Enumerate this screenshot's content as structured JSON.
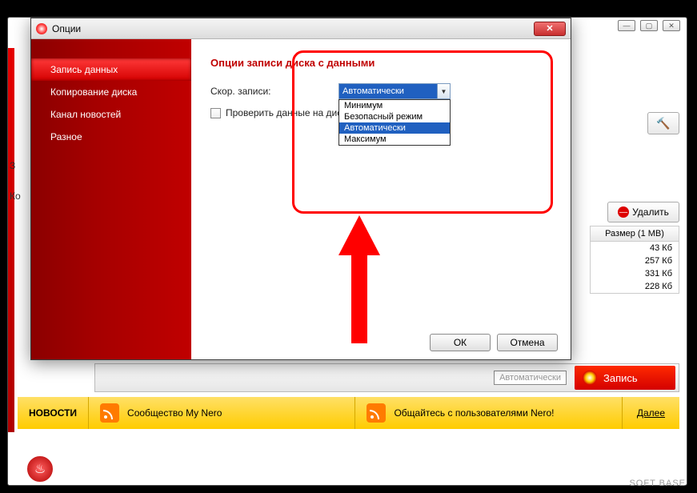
{
  "parent": {
    "delete_label": "Удалить",
    "size_header": "Размер (1 МВ)",
    "sizes": [
      "43 Кб",
      "257 Кб",
      "331 Кб",
      "228 Кб"
    ],
    "auto_label": "Автоматически",
    "burn_label": "Запись",
    "side_label_1": "З",
    "side_label_2": "Ко"
  },
  "news": {
    "label": "НОВОСТИ",
    "item1": "Сообщество My Nero",
    "item2": "Общайтесь с пользователями Nero!",
    "more": "Далее"
  },
  "dialog": {
    "title": "Опции",
    "nav": [
      "Запись данных",
      "Копирование диска",
      "Канал новостей",
      "Разное"
    ],
    "section_title": "Опции записи диска с данными",
    "speed_label": "Скор. записи:",
    "speed_value": "Автоматически",
    "verify_label": "Проверить данные на диске",
    "dropdown": [
      "Минимум",
      "Безопасный режим",
      "Автоматически",
      "Максимум"
    ],
    "ok": "ОК",
    "cancel": "Отмена"
  },
  "watermark": "SOFT BASE"
}
